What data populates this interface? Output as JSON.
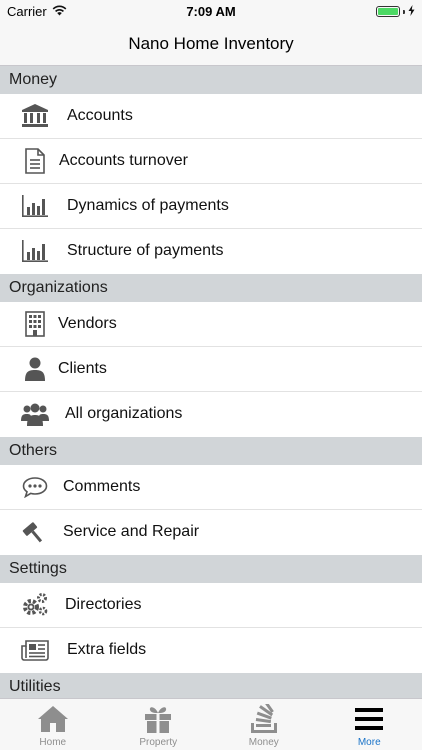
{
  "status_bar": {
    "carrier": "Carrier",
    "time": "7:09 AM",
    "battery_level": 1.0
  },
  "nav": {
    "title": "Nano Home Inventory"
  },
  "sections": [
    {
      "title": "Money",
      "items": [
        {
          "label": "Accounts",
          "icon": "bank-icon"
        },
        {
          "label": "Accounts turnover",
          "icon": "document-icon"
        },
        {
          "label": "Dynamics of payments",
          "icon": "bar-chart-icon"
        },
        {
          "label": "Structure of payments",
          "icon": "bar-chart-icon"
        }
      ]
    },
    {
      "title": "Organizations",
      "items": [
        {
          "label": "Vendors",
          "icon": "building-icon"
        },
        {
          "label": "Clients",
          "icon": "person-icon"
        },
        {
          "label": "All organizations",
          "icon": "group-icon"
        }
      ]
    },
    {
      "title": "Others",
      "items": [
        {
          "label": "Comments",
          "icon": "speech-bubble-icon"
        },
        {
          "label": "Service and Repair",
          "icon": "hammer-icon"
        }
      ]
    },
    {
      "title": "Settings",
      "items": [
        {
          "label": "Directories",
          "icon": "gears-icon"
        },
        {
          "label": "Extra fields",
          "icon": "newspaper-icon"
        }
      ]
    },
    {
      "title": "Utilities",
      "items": []
    }
  ],
  "tabs": [
    {
      "label": "Home",
      "icon": "home-icon",
      "active": false
    },
    {
      "label": "Property",
      "icon": "gift-icon",
      "active": false
    },
    {
      "label": "Money",
      "icon": "stack-icon",
      "active": false
    },
    {
      "label": "More",
      "icon": "menu-icon",
      "active": true
    }
  ],
  "colors": {
    "accent": "#1a73c8",
    "section_bg": "#d1d5d8",
    "icon": "#555555"
  }
}
